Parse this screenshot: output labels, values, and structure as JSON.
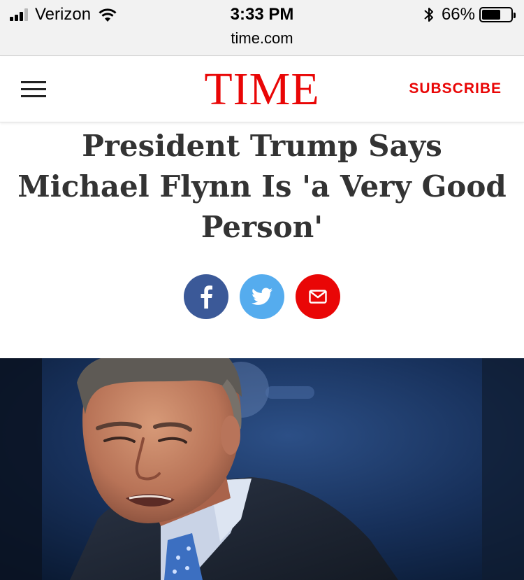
{
  "status_bar": {
    "carrier": "Verizon",
    "time": "3:33 PM",
    "battery_percent": "66%",
    "battery_level": 0.66,
    "url": "time.com"
  },
  "header": {
    "logo": "TIME",
    "subscribe_label": "SUBSCRIBE",
    "brand_color": "#e90606"
  },
  "article": {
    "headline_lines": [
      "President Trump Says",
      "Michael Flynn Is 'a Very Good",
      "Person'"
    ]
  },
  "share": {
    "facebook": {
      "icon": "facebook-icon",
      "color": "#3b5998"
    },
    "twitter": {
      "icon": "twitter-icon",
      "color": "#55acee"
    },
    "email": {
      "icon": "mail-icon",
      "color": "#e90606"
    }
  }
}
